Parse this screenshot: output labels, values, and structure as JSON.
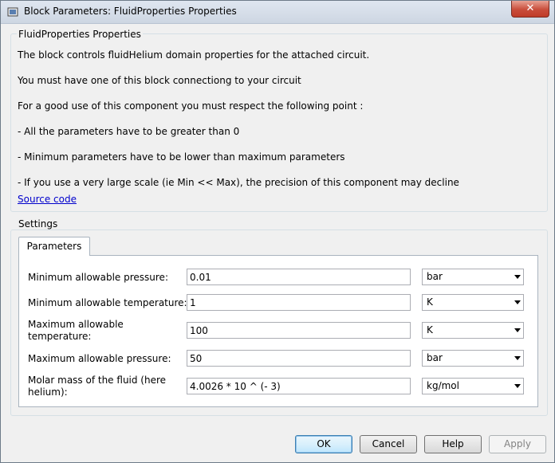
{
  "window": {
    "title": "Block Parameters: FluidProperties Properties",
    "close_glyph": "✕",
    "icon": "simulink-block-icon"
  },
  "description": {
    "group_title": "FluidProperties Properties",
    "lines": [
      "The block controls fluidHelium domain properties for the attached circuit.",
      "You must have one of this block connectiong to your circuit",
      "For a good use of this component you must respect the following point :",
      "- All the parameters have to be greater than 0",
      "- Minimum parameters have to be lower than maximum parameters",
      "- If you use a very large scale (ie Min << Max), the precision of this component may decline"
    ],
    "link": "Source code"
  },
  "settings": {
    "group_title": "Settings",
    "tab_label": "Parameters",
    "params": [
      {
        "label": "Minimum allowable pressure:",
        "value": "0.01",
        "unit": "bar"
      },
      {
        "label": "Minimum allowable temperature:",
        "value": "1",
        "unit": "K"
      },
      {
        "label": "Maximum allowable temperature:",
        "value": "100",
        "unit": "K"
      },
      {
        "label": "Maximum allowable pressure:",
        "value": "50",
        "unit": "bar"
      },
      {
        "label": "Molar mass of the fluid (here helium):",
        "value": "4.0026 * 10 ^ (- 3)",
        "unit": "kg/mol"
      }
    ]
  },
  "buttons": {
    "ok": "OK",
    "cancel": "Cancel",
    "help": "Help",
    "apply": "Apply"
  }
}
